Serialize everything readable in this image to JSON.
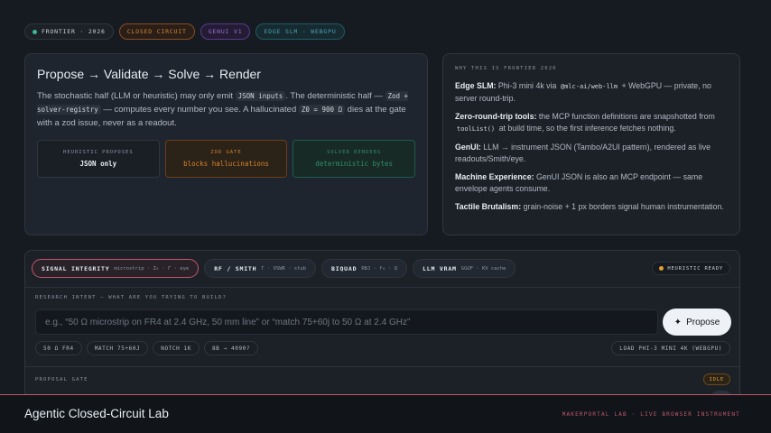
{
  "top_pills": {
    "frontier": "FRONTIER · 2026",
    "closed_circuit": "CLOSED CIRCUIT",
    "genui": "GENUI V1",
    "edge": "EDGE SLM · WEBGPU"
  },
  "pipeline": {
    "title": "Propose → Validate → Solve → Render",
    "desc_1": "The stochastic half (LLM or heuristic) may only emit ",
    "code_json": "JSON inputs",
    "desc_2": ". The deterministic half — ",
    "code_zod": "Zod + solver-registry",
    "desc_3": " — computes every number you see. A hallucinated ",
    "code_z0": "Z0 = 900 Ω",
    "desc_4": " dies at the gate with a zod issue, never as a readout.",
    "stages": [
      {
        "kicker": "HEURISTIC PROPOSES",
        "value": "JSON only"
      },
      {
        "kicker": "ZOD GATE",
        "value": "blocks hallucinations"
      },
      {
        "kicker": "SOLVER RENDERS",
        "value": "deterministic bytes"
      }
    ]
  },
  "why": {
    "heading": "WHY THIS IS FRONTIER 2026",
    "edge_title": "Edge SLM:",
    "edge_1": " Phi-3 mini 4k via ",
    "edge_code": "@mlc-ai/web-llm",
    "edge_2": " + WebGPU — private, no server round-trip.",
    "zero_title": "Zero-round-trip tools:",
    "zero_1": " the MCP function definitions are snapshotted from ",
    "zero_code": "toolList()",
    "zero_2": " at build time, so the first inference fetches nothing.",
    "genui_title": "GenUI:",
    "genui_text": " LLM → instrument JSON (Tambo/A2UI pattern), rendered as live readouts/Smith/eye.",
    "machine_title": "Machine Experience:",
    "machine_text": " GenUI JSON is also an MCP endpoint — same envelope agents consume.",
    "tactile_title": "Tactile Brutalism:",
    "tactile_text": " grain-noise + 1 px borders signal human instrumentation."
  },
  "workbench": {
    "tabs": [
      {
        "title": "SIGNAL INTEGRITY",
        "sub": "microstrip · Z₀ · Γ · eye"
      },
      {
        "title": "RF / SMITH",
        "sub": "Γ · VSWR · stub"
      },
      {
        "title": "BIQUAD",
        "sub": "RBJ · f₀ · Q"
      },
      {
        "title": "LLM VRAM",
        "sub": "GGUF · KV cache"
      }
    ],
    "status": "HEURISTIC READY",
    "intent_label": "RESEARCH INTENT — WHAT ARE YOU TRYING TO BUILD?",
    "intent_placeholder": "e.g., “50 Ω microstrip on FR4 at 2.4 GHz, 50 mm line” or “match 75+60j to 50 Ω at 2.4 GHz”",
    "propose_label": "Propose",
    "chips": [
      "50 Ω FR4",
      "MATCH 75+60J",
      "NOTCH 1K",
      "8B → 4090?"
    ],
    "load_label": "LOAD PHI-3 MINI 4K (WEBGPU)",
    "gate_label": "PROPOSAL GATE",
    "gate_status": "IDLE"
  },
  "footer": {
    "title": "Agentic Closed-Circuit Lab",
    "right": "MAKERPORTAL LAB · LIVE BROWSER INSTRUMENT"
  },
  "colors": {
    "accent": "#c2566a",
    "status_ready": "#e0a030",
    "ok": "#3fb98f"
  }
}
